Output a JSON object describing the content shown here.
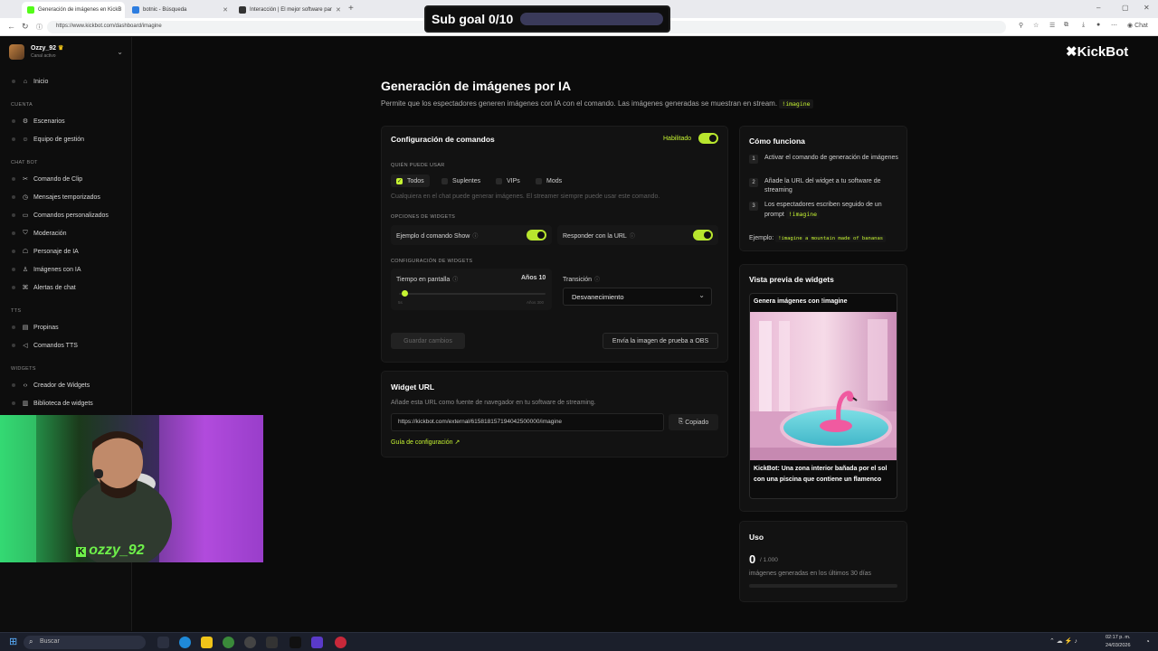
{
  "browser": {
    "tabs": [
      {
        "label": "Generación de imágenes en KickB",
        "active": true,
        "fav_color": "#53fc18"
      },
      {
        "label": "botnic - Búsqueda",
        "active": false,
        "fav_color": "#2d7de0"
      },
      {
        "label": "Interacción | El mejor software par",
        "active": false,
        "fav_color": "#333333"
      }
    ],
    "new_tab": "+",
    "url": "https://www.kickbot.com/dashboard/imagine",
    "chat_label": "Chat"
  },
  "overlay": {
    "sub_goal": "Sub goal 0/10",
    "webcam_nick": "ozzy_92"
  },
  "sidebar": {
    "profile_name": "Ozzy_92",
    "profile_status": "Canal activo",
    "home": {
      "label": "Inicio",
      "icon": "home-icon"
    },
    "sections": [
      {
        "title": "CUENTA",
        "items": [
          {
            "label": "Escenarios",
            "icon": "gear-icon"
          },
          {
            "label": "Equipo de gestión",
            "icon": "team-icon"
          }
        ]
      },
      {
        "title": "CHAT BOT",
        "items": [
          {
            "label": "Comando de Clip",
            "icon": "clip-icon"
          },
          {
            "label": "Mensajes temporizados",
            "icon": "timer-icon"
          },
          {
            "label": "Comandos personalizados",
            "icon": "command-icon"
          },
          {
            "label": "Moderación",
            "icon": "shield-icon"
          },
          {
            "label": "Personaje de IA",
            "icon": "bot-icon"
          },
          {
            "label": "Imágenes con IA",
            "icon": "image-icon"
          },
          {
            "label": "Alertas de chat",
            "icon": "alert-icon"
          }
        ]
      },
      {
        "title": "TTS",
        "items": [
          {
            "label": "Propinas",
            "icon": "tip-icon"
          },
          {
            "label": "Comandos TTS",
            "icon": "speaker-icon"
          }
        ]
      },
      {
        "title": "WIDGETS",
        "items": [
          {
            "label": "Creador de Widgets",
            "icon": "code-icon"
          },
          {
            "label": "Biblioteca de widgets",
            "icon": "library-icon"
          }
        ]
      }
    ]
  },
  "brand": "KickBot",
  "page": {
    "title": "Generación de imágenes por IA",
    "subtitle": "Permite que los espectadores generen imágenes con IA con el comando. Las imágenes generadas se muestran en stream.",
    "command": "!imagine"
  },
  "config": {
    "title": "Configuración de comandos",
    "enabled_label": "Habilitado",
    "who_label": "QUIÉN PUEDE USAR",
    "roles": [
      {
        "label": "Todos",
        "checked": true
      },
      {
        "label": "Suplentes",
        "checked": false
      },
      {
        "label": "VIPs",
        "checked": false
      },
      {
        "label": "Mods",
        "checked": false
      }
    ],
    "roles_hint": "Cualquiera en el chat puede generar imágenes. El streamer siempre puede usar este comando.",
    "widget_options_label": "OPCIONES DE WIDGETS",
    "option_example": "Ejemplo d comando Show",
    "option_reply": "Responder con la URL",
    "widget_config_label": "CONFIGURACIÓN DE WIDGETS",
    "screen_time_label": "Tiempo en pantalla",
    "screen_time_value": "Años 10",
    "slider_min": "5s",
    "slider_max": "Años 300",
    "slider_level": 0.03,
    "transition_label": "Transición",
    "transition_value": "Desvanecimiento",
    "save_label": "Guardar cambios",
    "test_label": "Envía la imagen de prueba a OBS"
  },
  "widget_url": {
    "title": "Widget URL",
    "desc": "Añade esta URL como fuente de navegador en tu software de streaming.",
    "url": "https://kickbot.com/external/615818157194042500000/imagine",
    "copy_label": "Copiado",
    "guide_label": "Guía de configuración"
  },
  "how": {
    "title": "Cómo funciona",
    "steps": [
      {
        "n": "1",
        "text": "Activar el comando de generación de imágenes"
      },
      {
        "n": "2",
        "text": "Añade la URL del widget a tu software de streaming"
      },
      {
        "n": "3",
        "text": "Los espectadores escriben seguido de un prompt"
      }
    ],
    "step3_code": "!imagine",
    "example_label": "Ejemplo:",
    "example_code": "!imagine a mountain made of bananas"
  },
  "preview": {
    "title": "Vista previa de widgets",
    "header": "Genera imágenes con !imagine",
    "caption": "KickBot: Una zona interior bañada por el sol con una piscina que contiene un flamenco"
  },
  "usage": {
    "title": "Uso",
    "count": "0",
    "limit": "/ 1.000",
    "desc": "imágenes generadas en los últimos 30 días",
    "level": 0.0
  },
  "taskbar": {
    "search_label": "Buscar",
    "time": "02:17 p. m.",
    "date": "24/03/2026"
  },
  "colors": {
    "accent": "#c6f432",
    "bg": "#0b0b0b",
    "card": "#121212"
  }
}
